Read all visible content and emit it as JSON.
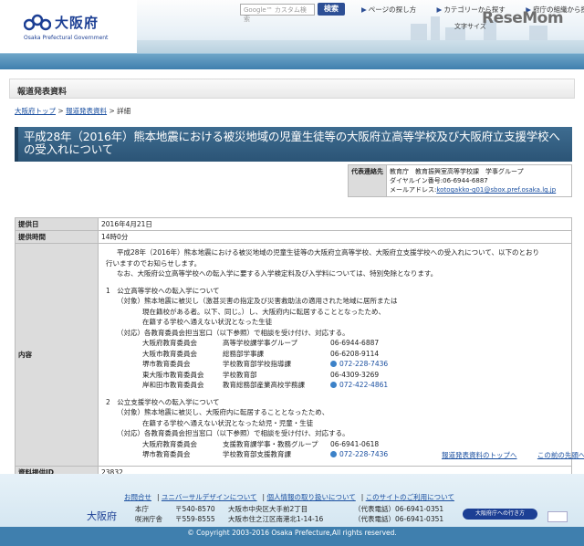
{
  "header": {
    "logo_jp": "大阪府",
    "logo_en": "Osaka Prefectural Government",
    "search_placeholder": "Google™ カスタム検索",
    "search_button": "検索",
    "links": [
      "ページの探し方",
      "カテゴリーから探す",
      "府庁の組織から探す"
    ],
    "font_size_label": "文字サイズ",
    "watermark": "ReseMom"
  },
  "section_heading": "報道発表資料",
  "breadcrumb": {
    "items": [
      "大阪府トップ",
      "報道発表資料",
      "詳細"
    ],
    "separator": " > "
  },
  "title": "平成28年（2016年）熊本地震における被災地域の児童生徒等の大阪府立高等学校及び大阪府立支援学校への受入れについて",
  "contact": {
    "key": "代表連絡先",
    "dept": "教育庁　教育振興室高等学校課　学事グループ",
    "dial": "ダイヤルイン番号:06-6944-6887",
    "mail_label": "メールアドレス:",
    "mail": "kotogakko-g01@sbox.pref.osaka.lg.jp"
  },
  "info": {
    "date_key": "提供日",
    "date_val": "2016年4月21日",
    "time_key": "提供時間",
    "time_val": "14時0分",
    "content_key": "内容",
    "id_key": "資料提供ID",
    "id_val": "23832"
  },
  "content": {
    "intro1": "平成28年（2016年）熊本地震における被災地域の児童生徒等の大阪府立高等学校、大阪府立支援学校への受入れについて、以下のとおり",
    "intro2": "行いますのでお知らせします。",
    "intro3": "なお、大阪府公立高等学校への転入学に要する入学検定料及び入学料については、特別免除となります。",
    "sec1_title": "1　公立高等学校への転入学について",
    "sec1_target1": "（対象）熊本地震に被災し（激甚災害の指定及び災害救助法の適用された地域に居所または",
    "sec1_target2": "現在籍校がある者。以下、同じ。）し、大阪府内に転居することとなったため、",
    "sec1_target3": "在籍する学校へ通えない状況となった生徒",
    "sec1_handling": "（対応）各教育委員会担当窓口（以下参照）で相談を受け付け、対応する。",
    "sec1_rows": [
      {
        "org": "大阪府教育委員会",
        "dept": "高等学校課学事グループ",
        "tel": "06-6944-6887",
        "icon": false
      },
      {
        "org": "大阪市教育委員会",
        "dept": "総務部学事課",
        "tel": "06-6208-9114",
        "icon": false
      },
      {
        "org": "堺市教育委員会",
        "dept": "学校教育部学校指導課",
        "tel": "072-228-7436",
        "icon": true
      },
      {
        "org": "東大阪市教育委員会",
        "dept": "学校教育部",
        "tel": "06-4309-3269",
        "icon": false
      },
      {
        "org": "岸和田市教育委員会",
        "dept": "教育総務部産業高校学務課",
        "tel": "072-422-4861",
        "icon": true
      }
    ],
    "sec2_title": "2　公立支援学校への転入学について",
    "sec2_target1": "（対象）熊本地震に被災し、大阪府内に転居することとなったため、",
    "sec2_target2": "在籍する学校へ通えない状況となった幼児・児童・生徒",
    "sec2_handling": "（対応）各教育委員会担当窓口（以下参照）で相談を受け付け、対応する。",
    "sec2_rows": [
      {
        "org": "大阪府教育委員会",
        "dept": "支援教育課学事・教務グループ",
        "tel": "06-6941-0618",
        "icon": false
      },
      {
        "org": "堺市教育委員会",
        "dept": "学校教育部支援教育課",
        "tel": "072-228-7436",
        "icon": true
      }
    ]
  },
  "footer_nav": {
    "back_list": "報道発表資料のトップへ",
    "prev_page": "この前の先頭へ"
  },
  "footer": {
    "links": [
      "お問合せ",
      "ユニバーサルデザインについて",
      "個人情報の取り扱いについて",
      "このサイトのご利用について"
    ],
    "name": "大阪府",
    "rows": [
      {
        "place": "本庁",
        "zip": "〒540-8570",
        "addr": "大阪市中央区大手前2丁目",
        "tel": "（代表電話）06-6941-0351"
      },
      {
        "place": "咲洲庁舎",
        "zip": "〒559-8555",
        "addr": "大阪市住之江区南港北1-14-16",
        "tel": "（代表電話）06-6941-0351"
      }
    ],
    "access_button": "大阪府庁への行き方",
    "copyright": "© Copyright 2003-2016 Osaka Prefecture,All rights reserved."
  }
}
